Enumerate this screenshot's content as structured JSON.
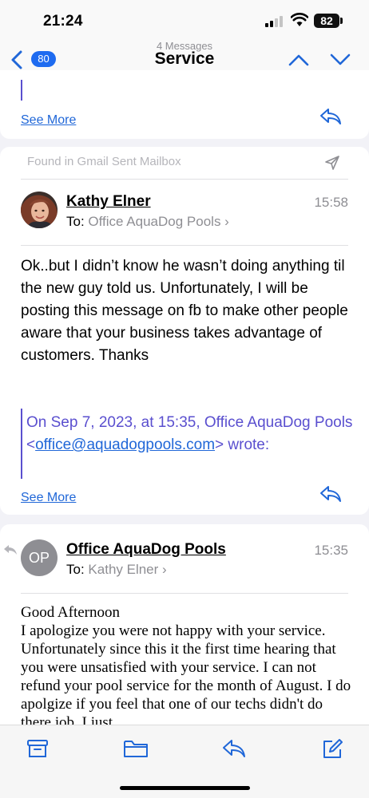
{
  "status": {
    "time": "21:24",
    "battery": "82"
  },
  "nav": {
    "unread_count": "80",
    "message_count": "4 Messages",
    "title": "Service"
  },
  "card1": {
    "see_more": "See More"
  },
  "card2": {
    "found_in": "Found in Gmail Sent Mailbox",
    "sender": "Kathy Elner",
    "to_label": "To:",
    "to": "Office AquaDog Pools",
    "time": "15:58",
    "body": "Ok..but I didn’t know he wasn’t doing anything til the new guy told us. Unfortunately, I will be posting this message on fb to make other people aware that your business takes advantage of customers. Thanks",
    "quote_prefix": "On Sep 7, 2023, at 15:35, Office AquaDog Pools <",
    "quote_email": "office@aquadogpools.com",
    "quote_suffix": "> wrote:",
    "see_more": "See More"
  },
  "card3": {
    "avatar_initials": "OP",
    "sender": "Office AquaDog Pools",
    "to_label": "To:",
    "to": "Kathy Elner",
    "time": "15:35",
    "greeting": "Good Afternoon",
    "body": "I apologize you were not happy with your service. Unfortunately since this it the first time hearing that you were unsatisfied with your service. I can not refund your pool service  for the month of  August. I do apolgize if you feel that one of our techs didn't do there job. I just"
  },
  "colors": {
    "accent": "#2067d8",
    "quote": "#5a4fcf",
    "secondary_text": "#8e8e93"
  },
  "icons": {
    "back": "chevron-left-icon",
    "up": "chevron-up-icon",
    "down": "chevron-down-icon",
    "reply": "reply-icon",
    "sent": "paper-plane-icon",
    "archive": "archive-icon",
    "folder": "folder-icon",
    "compose": "compose-icon"
  }
}
